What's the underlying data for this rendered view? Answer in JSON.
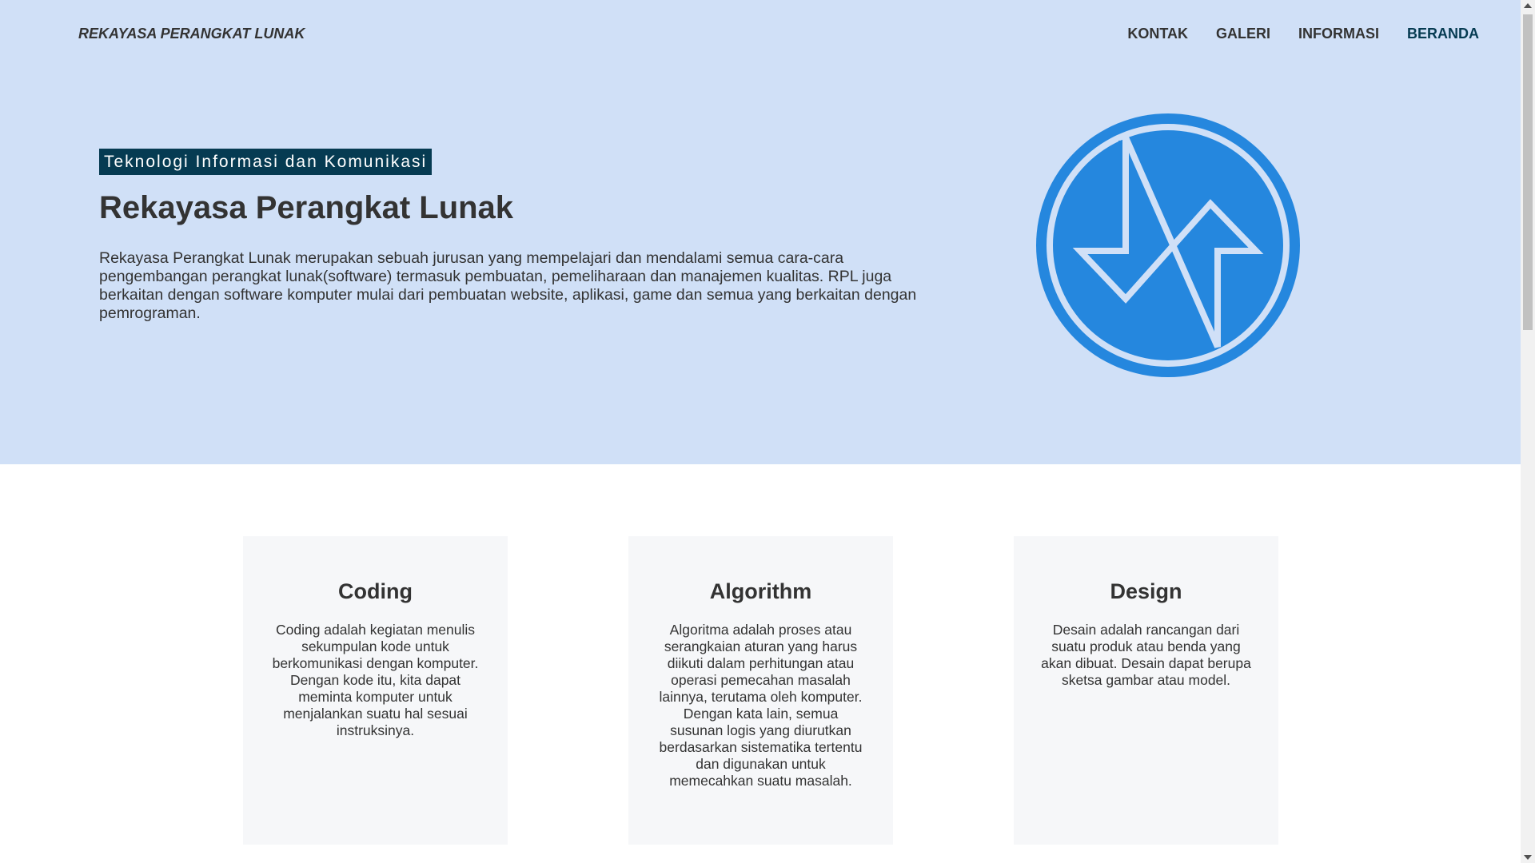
{
  "header": {
    "brand": "REKAYASA PERANGKAT LUNAK",
    "nav": [
      {
        "label": "KONTAK"
      },
      {
        "label": "GALERI"
      },
      {
        "label": "INFORMASI"
      },
      {
        "label": "BERANDA",
        "active": true
      }
    ]
  },
  "hero": {
    "tagline": "Teknologi Informasi dan Komunikasi",
    "title": "Rekayasa Perangkat Lunak",
    "description": "Rekayasa Perangkat Lunak merupakan sebuah jurusan yang mempelajari dan mendalami semua cara-cara pengembangan perangkat lunak(software) termasuk pembuatan, pemeliharaan dan manajemen kualitas. RPL juga berkaitan dengan software komputer mulai dari pembuatan website, aplikasi, game dan semua yang berkaitan dengan pemrograman.",
    "logo_icon": "rpl-logo-icon"
  },
  "cards": [
    {
      "title": "Coding",
      "text": "Coding adalah kegiatan menulis sekumpulan kode untuk berkomunikasi dengan komputer. Dengan kode itu, kita dapat meminta komputer untuk menjalankan suatu hal sesuai instruksinya."
    },
    {
      "title": "Algorithm",
      "text": "Algoritma adalah proses atau serangkaian aturan yang harus diikuti dalam perhitungan atau operasi pemecahan masalah lainnya, terutama oleh komputer. Dengan kata lain, semua susunan logis yang diurutkan berdasarkan sistematika tertentu dan digunakan untuk memecahkan suatu masalah."
    },
    {
      "title": "Design",
      "text": "Desain adalah rancangan dari suatu produk atau benda yang akan dibuat. Desain dapat berupa sketsa gambar atau model."
    }
  ],
  "colors": {
    "hero_bg": "#d0e0f7",
    "accent": "#063b52",
    "logo_blue": "#2587de",
    "card_bg": "#f6f7f9"
  }
}
